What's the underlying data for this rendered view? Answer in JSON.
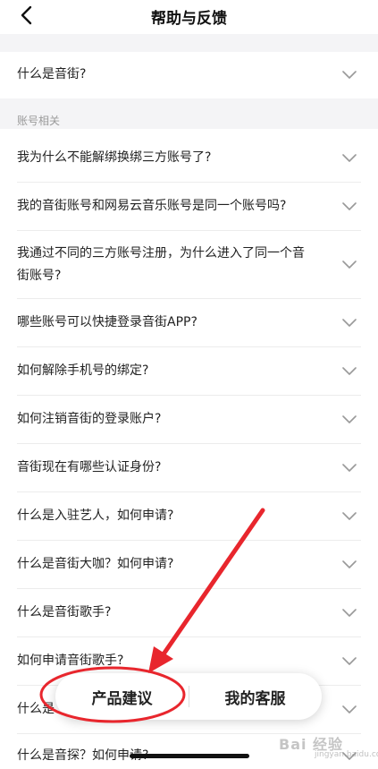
{
  "header": {
    "title": "帮助与反馈"
  },
  "section_label": "账号相关",
  "top_item": {
    "label": "什么是音街?"
  },
  "items": [
    {
      "label": "我为什么不能解绑换绑三方账号了?"
    },
    {
      "label": "我的音街账号和网易云音乐账号是同一个账号吗?"
    },
    {
      "label": "我通过不同的三方账号注册，为什么进入了同一个音街账号?"
    },
    {
      "label": "哪些账号可以快捷登录音街APP?"
    },
    {
      "label": "如何解除手机号的绑定?"
    },
    {
      "label": "如何注销音街的登录账户?"
    },
    {
      "label": "音街现在有哪些认证身份?"
    },
    {
      "label": "什么是入驻艺人，如何申请?"
    },
    {
      "label": "什么是音街大咖？如何申请?"
    },
    {
      "label": "什么是音街歌手?"
    },
    {
      "label": "如何申请音街歌手?"
    },
    {
      "label": "什么是"
    },
    {
      "label": "什么是音探？如何申请?"
    }
  ],
  "bottom_bar": {
    "suggest_label": "产品建议",
    "service_label": "我的客服"
  },
  "watermark": {
    "text": "Bai 经验",
    "sub": "jingyan.baidu.com"
  },
  "colors": {
    "annotation_red": "#e8262d",
    "background_band": "#f4f4f6"
  }
}
